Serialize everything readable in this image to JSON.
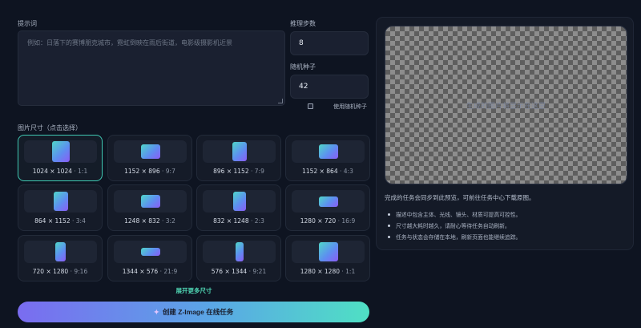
{
  "prompt": {
    "label": "提示词",
    "placeholder": "例如：日落下的赛博朋克城市，霓虹倒映在雨后街道，电影级摄影机近景"
  },
  "steps": {
    "label": "推理步数",
    "value": "8"
  },
  "seed": {
    "label": "随机种子",
    "value": "42",
    "random_label": "使用随机种子",
    "random_checked": false
  },
  "sizes": {
    "label": "图片尺寸（点击选择）",
    "items": [
      {
        "dims": "1024 × 1024",
        "ratio": "· 1:1",
        "selected": true
      },
      {
        "dims": "1152 × 896",
        "ratio": "· 9:7",
        "selected": false
      },
      {
        "dims": "896 × 1152",
        "ratio": "· 7:9",
        "selected": false
      },
      {
        "dims": "1152 × 864",
        "ratio": "· 4:3",
        "selected": false
      },
      {
        "dims": "864 × 1152",
        "ratio": "· 3:4",
        "selected": false
      },
      {
        "dims": "1248 × 832",
        "ratio": "· 3:2",
        "selected": false
      },
      {
        "dims": "832 × 1248",
        "ratio": "· 2:3",
        "selected": false
      },
      {
        "dims": "1280 × 720",
        "ratio": "· 16:9",
        "selected": false
      },
      {
        "dims": "720 × 1280",
        "ratio": "· 9:16",
        "selected": false
      },
      {
        "dims": "1344 × 576",
        "ratio": "· 21:9",
        "selected": false
      },
      {
        "dims": "576 × 1344",
        "ratio": "· 9:21",
        "selected": false
      },
      {
        "dims": "1280 × 1280",
        "ratio": "· 1:1",
        "selected": false
      }
    ],
    "expand_label": "展开更多尺寸"
  },
  "create_button": {
    "icon": "sparkle-icon",
    "label": "创建 Z-Image 在线任务"
  },
  "preview": {
    "placeholder": "生成的图片将显示在这里",
    "note": "完成的任务会同步到此预览，可前往任务中心下载原图。",
    "tips": [
      "描述中包含主体、光线、镜头、材质可提高可控性。",
      "尺寸越大耗时越久，请耐心等待任务自动刷新。",
      "任务与状态会存储在本地，刷新页面也能继续追踪。"
    ]
  },
  "colors": {
    "background": "#0e1421",
    "accent_teal": "#4fd6b4",
    "accent_purple": "#7a6cf0"
  }
}
